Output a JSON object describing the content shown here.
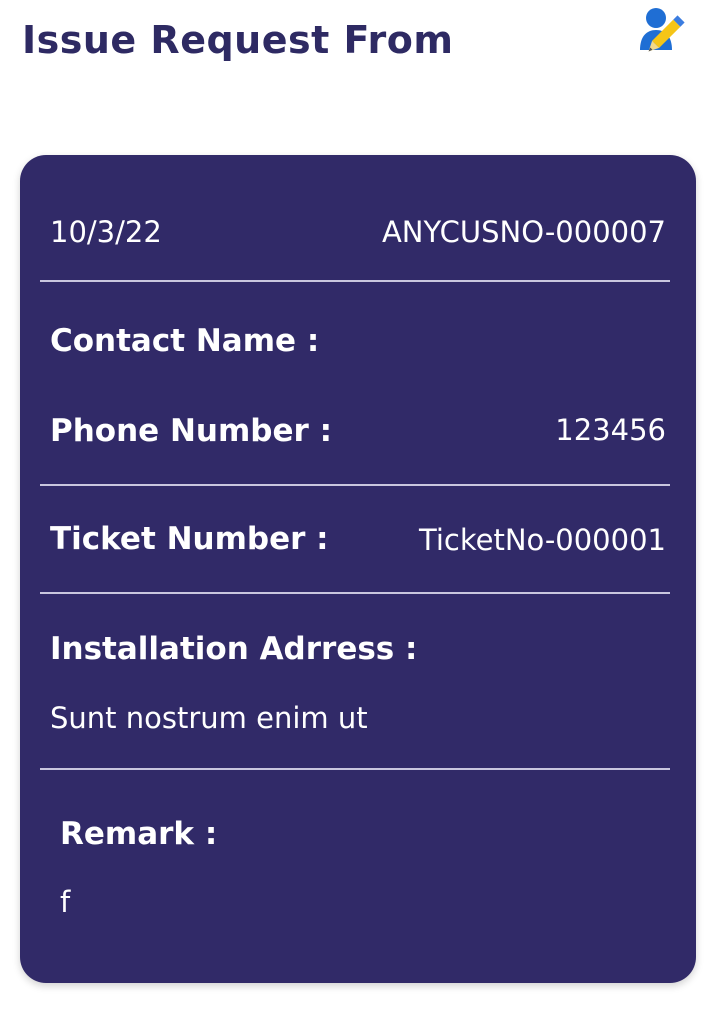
{
  "header": {
    "title": "Issue Request From",
    "icon": "user-edit-icon"
  },
  "card": {
    "date": "10/3/22",
    "customer_no": "ANYCUSNO-000007",
    "contact_name_label": "Contact Name :",
    "contact_name_value": "",
    "phone_label": "Phone Number :",
    "phone_value": "123456",
    "ticket_label": "Ticket Number :",
    "ticket_value": "TicketNo-000001",
    "address_label": "Installation Adrress :",
    "address_value": "Sunt nostrum enim ut",
    "remark_label": "Remark :",
    "remark_value": "f"
  },
  "colors": {
    "card_background": "#312a68",
    "title_color": "#2e2a63",
    "icon_person": "#1f6ed4",
    "icon_pencil": "#f5c518"
  }
}
